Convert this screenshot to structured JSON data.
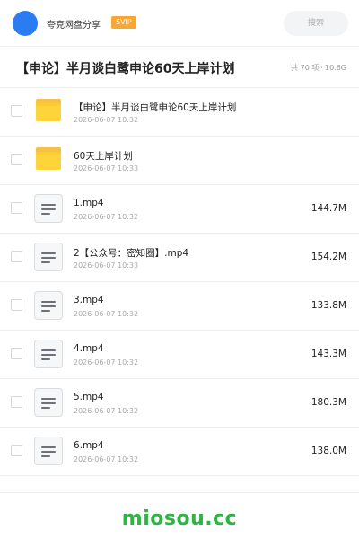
{
  "header": {
    "brand": "夸克网盘分享",
    "badge": "SVIP",
    "search_label": "搜索"
  },
  "share": {
    "title": "【申论】半月谈白鹭申论60天上岸计划",
    "item_count": "共 70 项",
    "total_size": "10.6G"
  },
  "files": [
    {
      "type": "folder",
      "icon": "folder-icon",
      "name": "【申论】半月谈白鹭申论60天上岸计划",
      "date": "2026-06-07 10:32",
      "size": ""
    },
    {
      "type": "folder",
      "icon": "folder-icon",
      "name": "60天上岸计划",
      "date": "2026-06-07 10:33",
      "size": ""
    },
    {
      "type": "file",
      "icon": "video-file-icon",
      "name": "1.mp4",
      "date": "2026-06-07 10:32",
      "size": "144.7M"
    },
    {
      "type": "file",
      "icon": "video-file-icon",
      "name": "2【公众号：密知圈】.mp4",
      "date": "2026-06-07 10:33",
      "size": "154.2M"
    },
    {
      "type": "file",
      "icon": "video-file-icon",
      "name": "3.mp4",
      "date": "2026-06-07 10:32",
      "size": "133.8M"
    },
    {
      "type": "file",
      "icon": "video-file-icon",
      "name": "4.mp4",
      "date": "2026-06-07 10:32",
      "size": "143.3M"
    },
    {
      "type": "file",
      "icon": "video-file-icon",
      "name": "5.mp4",
      "date": "2026-06-07 10:32",
      "size": "180.3M"
    },
    {
      "type": "file",
      "icon": "video-file-icon",
      "name": "6.mp4",
      "date": "2026-06-07 10:32",
      "size": "138.0M"
    }
  ],
  "footer": {
    "watermark": "miosou.cc"
  },
  "colors": {
    "accent": "#2b7bf3",
    "badge": "#f7a733",
    "folder": "#ffcd2a",
    "watermark": "#2db543"
  }
}
